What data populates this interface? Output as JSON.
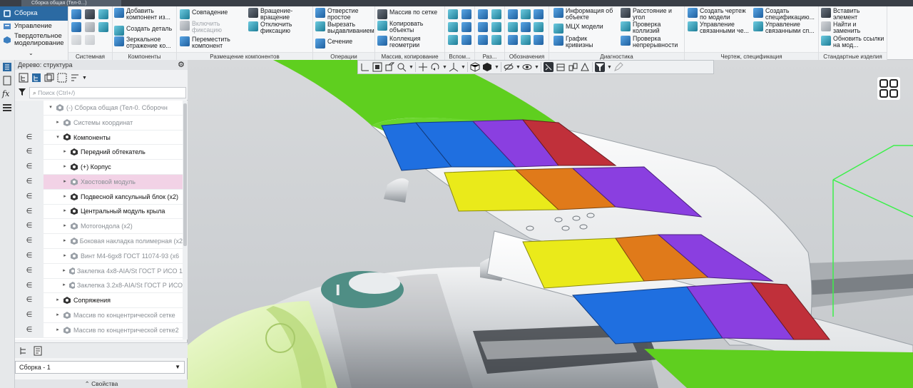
{
  "window": {
    "tab_title": "Сборка общая (Тел-0...)"
  },
  "modes": {
    "active": "Сборка",
    "items": [
      "Управление",
      "Твердотельное моделирование"
    ]
  },
  "ribbon": {
    "groups": [
      {
        "label": "Системная"
      },
      {
        "label": "Компоненты",
        "buttons": [
          "Добавить компонент из...",
          "Создать деталь",
          "Зеркальное отражение ко..."
        ]
      },
      {
        "label": "Размещение компонентов",
        "buttons": [
          "Совпадение",
          "Включить фиксацию",
          "Переместить компонент",
          "Вращение-вращение",
          "Отключить фиксацию"
        ]
      },
      {
        "label": "Операции",
        "buttons": [
          "Отверстие простое",
          "Вырезать выдавливанием",
          "Сечение"
        ]
      },
      {
        "label": "Массив, копирование",
        "buttons": [
          "Массив по сетке",
          "Копировать объекты",
          "Коллекция геометрии"
        ]
      },
      {
        "label": "Вспом..."
      },
      {
        "label": "Раз..."
      },
      {
        "label": "Обозначения"
      },
      {
        "label": "Диагностика",
        "buttons": [
          "Информация об объекте",
          "МЦХ модели",
          "График кривизны",
          "Расстояние и угол",
          "Проверка коллизий",
          "Проверка непрерывности"
        ]
      },
      {
        "label": "Чертеж, спецификация",
        "buttons": [
          "Создать чертеж по модели",
          "Управление связанными че...",
          "Создать спецификацию...",
          "Управление связанными сп..."
        ]
      },
      {
        "label": "Стандартные изделия",
        "buttons": [
          "Вставить элемент",
          "Найти и заменить",
          "Обновить ссылки на мод..."
        ]
      }
    ]
  },
  "panel": {
    "title": "Дерево: структура",
    "search_placeholder": "Поиск (Ctrl+/)",
    "tree": [
      {
        "mark": "",
        "label": "(-) Сборка общая (Тел-0. Сборочн",
        "tone": "gray",
        "indent": 0,
        "arrow": "▾"
      },
      {
        "mark": "",
        "label": "Системы координат",
        "tone": "gray",
        "indent": 1,
        "arrow": "▸"
      },
      {
        "mark": "∈",
        "label": "Компоненты",
        "tone": "dark",
        "indent": 1,
        "arrow": "▾"
      },
      {
        "mark": "∈",
        "label": "Передний обтекатель",
        "tone": "dark",
        "indent": 2,
        "arrow": "▸"
      },
      {
        "mark": "∈",
        "label": "(+) Корпус",
        "tone": "dark",
        "indent": 2,
        "arrow": "▸"
      },
      {
        "mark": "∈",
        "label": "Хвостовой модуль",
        "tone": "gray",
        "indent": 2,
        "arrow": "▸",
        "highlight": true
      },
      {
        "mark": "∈",
        "label": "Подвесной капсульный блок (x2)",
        "tone": "dark",
        "indent": 2,
        "arrow": "▸"
      },
      {
        "mark": "∈",
        "label": "Центральный модуль крыла",
        "tone": "dark",
        "indent": 2,
        "arrow": "▸"
      },
      {
        "mark": "∈",
        "label": "Мотогондола (x2)",
        "tone": "gray",
        "indent": 2,
        "arrow": "▸"
      },
      {
        "mark": "∈",
        "label": "Боковая накладка полимерная (x2",
        "tone": "gray",
        "indent": 2,
        "arrow": "▸"
      },
      {
        "mark": "∈",
        "label": "Винт М4-6gx8 ГОСТ 11074-93 (x6",
        "tone": "gray",
        "indent": 2,
        "arrow": "▸"
      },
      {
        "mark": "∈",
        "label": "Заклепка 4x8-AIA/St ГОСТ Р ИСО 1",
        "tone": "gray",
        "indent": 2,
        "arrow": "▸"
      },
      {
        "mark": "∈",
        "label": "Заклепка 3.2x8-AIA/St ГОСТ Р ИСО",
        "tone": "gray",
        "indent": 2,
        "arrow": "▸"
      },
      {
        "mark": "∈",
        "label": "Сопряжения",
        "tone": "dark",
        "indent": 1,
        "arrow": "▸"
      },
      {
        "mark": "∈",
        "label": "Массив по концентрической сетке",
        "tone": "gray",
        "indent": 1,
        "arrow": "▸"
      },
      {
        "mark": "∈",
        "label": "Массив по концентрической сетке2",
        "tone": "gray",
        "indent": 1,
        "arrow": "▸"
      }
    ],
    "assembly_select": "Сборка - 1",
    "properties_label": "Свойства"
  },
  "colors": {
    "accent": "#2b6aa3",
    "highlight_row": "#f2d2e6",
    "wing_green": "#5fcf1f",
    "panel_blue": "#1f6fe0",
    "panel_yellow": "#eaea1a",
    "panel_purple": "#8a3fe0",
    "panel_red": "#c0303a",
    "panel_orange": "#e07a1a",
    "nacelle_lime": "#d8f59a"
  }
}
